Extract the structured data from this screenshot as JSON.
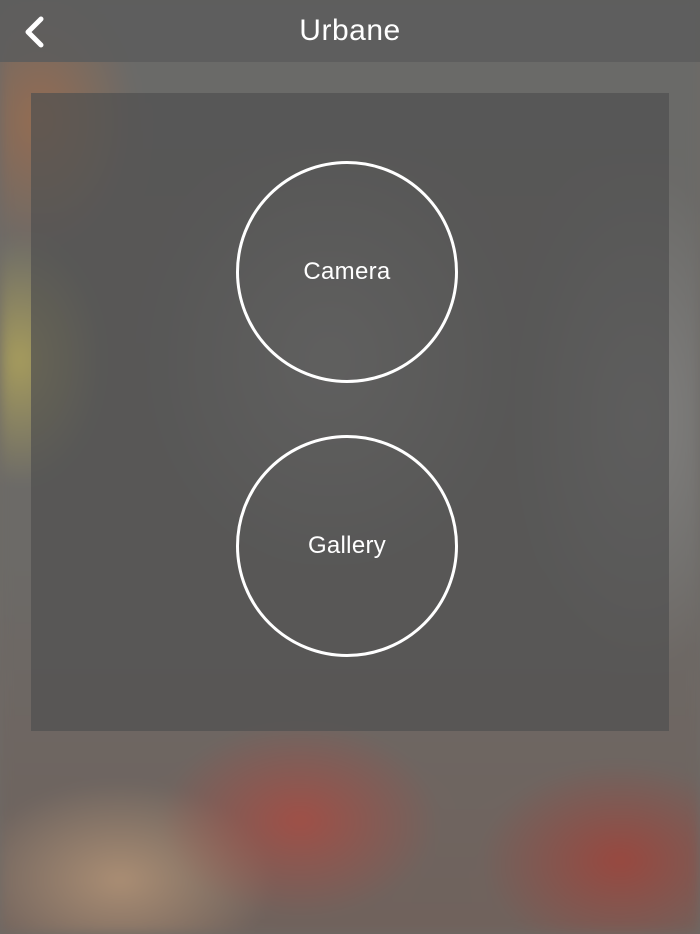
{
  "header": {
    "title": "Urbane",
    "back_icon": "chevron-left-icon"
  },
  "options": {
    "camera_label": "Camera",
    "gallery_label": "Gallery"
  },
  "colors": {
    "text": "#ffffff",
    "bar_overlay": "#5c5c5c",
    "panel_overlay": "#505050"
  }
}
